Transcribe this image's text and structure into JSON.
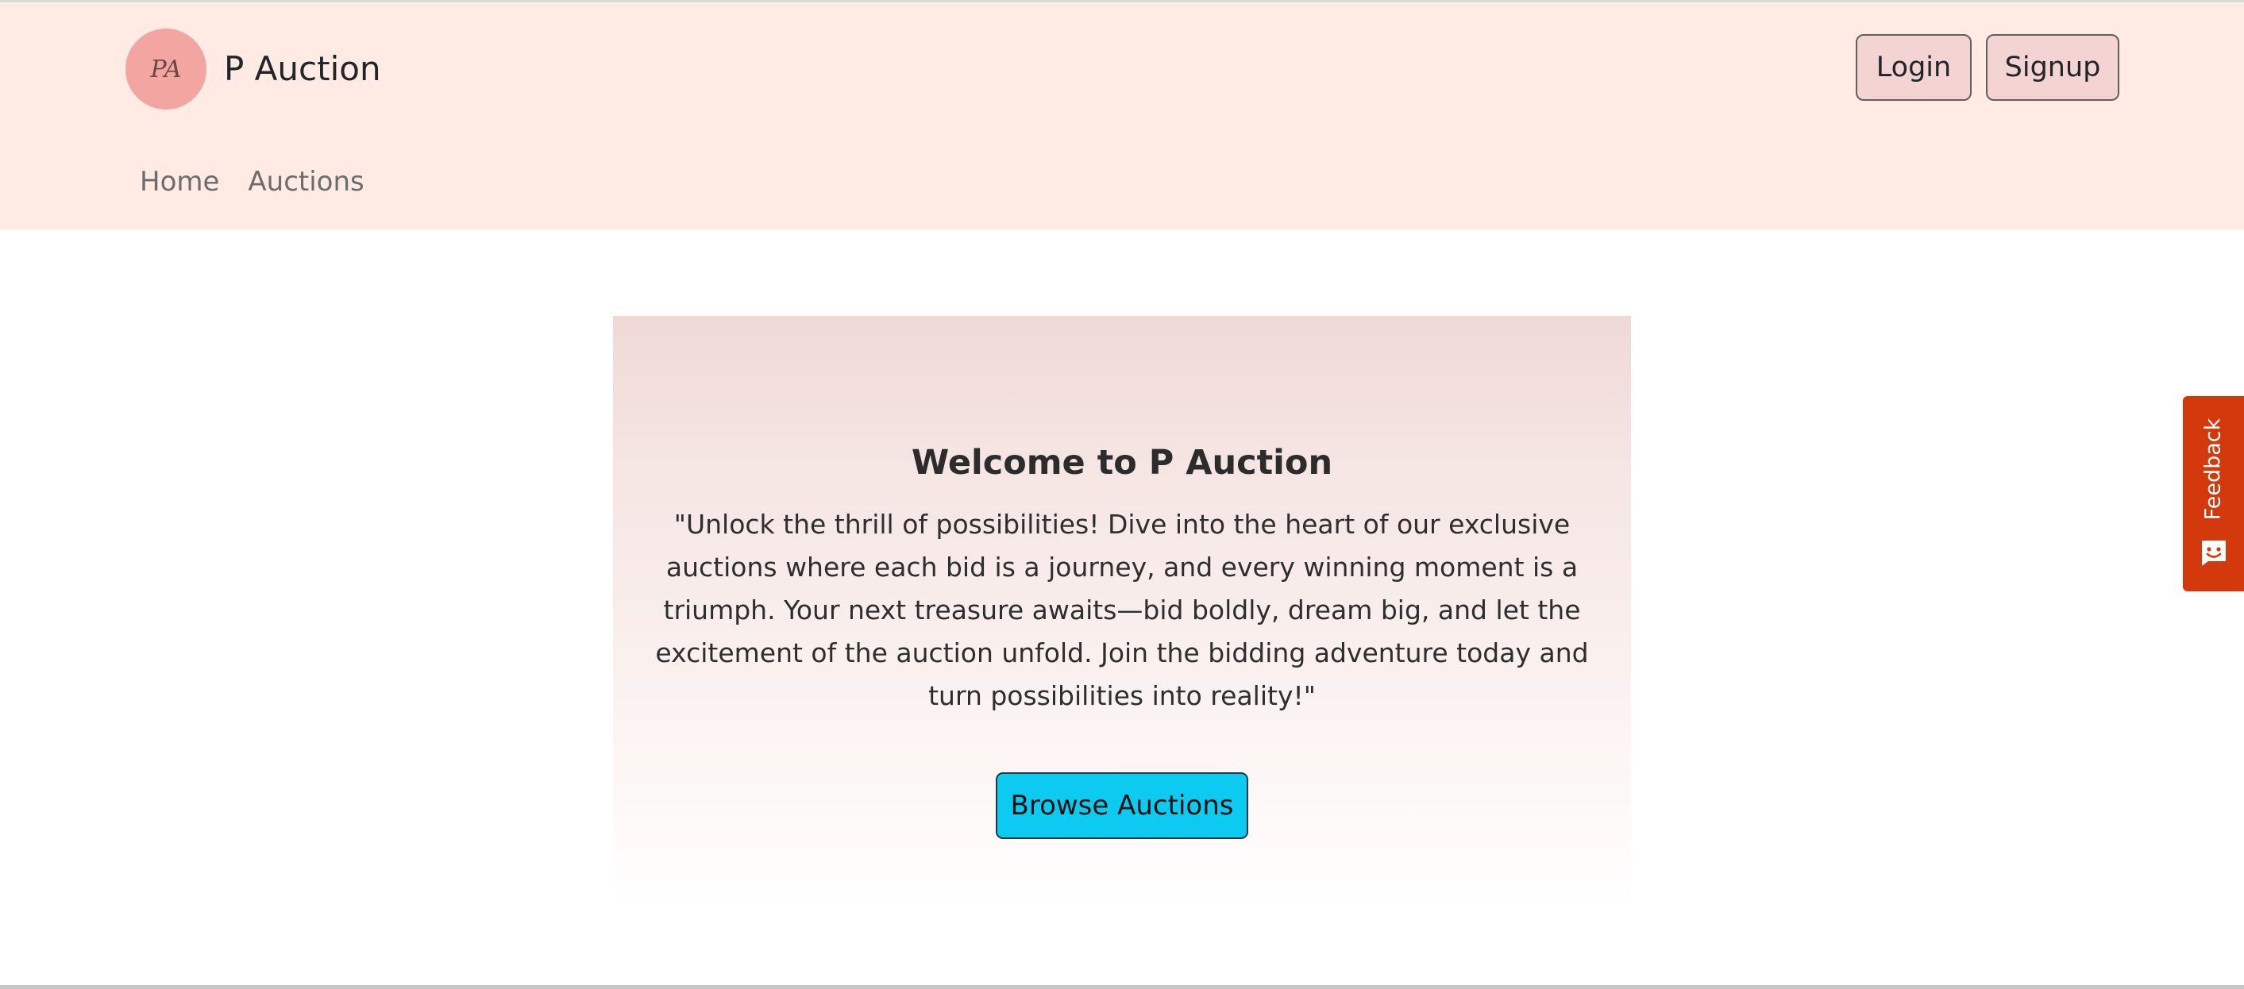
{
  "brand": {
    "logo_text": "PA",
    "name": "P Auction"
  },
  "header": {
    "login_label": "Login",
    "signup_label": "Signup"
  },
  "nav": {
    "items": [
      {
        "label": "Home"
      },
      {
        "label": "Auctions"
      }
    ]
  },
  "hero": {
    "title": "Welcome to P Auction",
    "text": "\"Unlock the thrill of possibilities! Dive into the heart of our exclusive auctions where each bid is a journey, and every winning moment is a triumph. Your next treasure awaits—bid boldly, dream big, and let the excitement of the auction unfold. Join the bidding adventure today and turn possibilities into reality!\"",
    "cta_label": "Browse Auctions"
  },
  "feedback": {
    "label": "Feedback",
    "icon": "chat-smile-icon"
  },
  "colors": {
    "header_bg": "#ffebe3",
    "logo_bg": "#f3a5a1",
    "auth_button_bg": "#f3d4d2",
    "cta_bg": "#0dcaf0",
    "feedback_bg": "#d4380d"
  }
}
